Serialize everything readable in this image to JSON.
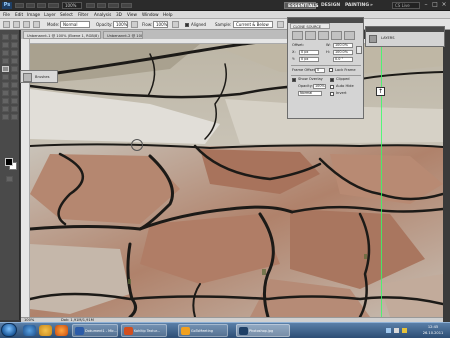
{
  "app": {
    "logo": "Ps",
    "zoom": "100%",
    "workspaces": [
      "ESSENTIALS",
      "DESIGN",
      "PAINTING",
      "»"
    ],
    "cs_live": "CS Live"
  },
  "menu": [
    "File",
    "Edit",
    "Image",
    "Layer",
    "Select",
    "Filter",
    "Analysis",
    "3D",
    "View",
    "Window",
    "Help"
  ],
  "options_bar": {
    "mode_label": "Mode:",
    "mode_value": "Normal",
    "opacity_label": "Opacity:",
    "opacity_value": "100%",
    "flow_label": "Flow:",
    "flow_value": "100%",
    "aligned_label": "Aligned",
    "sample_label": "Sample:",
    "sample_value": "Current & Below"
  },
  "document": {
    "tabs": [
      "Unbenannt-1 @ 100% (Ebene 1, RGB/8)",
      "Unbenannt-2 @ 100%"
    ]
  },
  "status": {
    "zoom": "100%",
    "doc_info": "Dok: 1,91M/1,91M"
  },
  "brush_popup": {
    "label": "Brushes"
  },
  "clone_source_panel": {
    "tabs": [
      "CLONE SOURCE"
    ],
    "offset_label": "Offset:",
    "w_label": "W:",
    "w_value": "100.0%",
    "h_label": "H:",
    "h_value": "100.0%",
    "x_label": "X:",
    "x_value": "0 px",
    "y_label": "Y:",
    "y_value": "0 px",
    "angle_value": "0.0 °",
    "frame_offset_label": "Frame Offset:",
    "frame_offset_value": "0",
    "lock_frame_label": "Lock Frame",
    "show_overlay_label": "Show Overlay",
    "clipped_label": "Clipped",
    "opacity_label": "Opacity:",
    "opacity_value": "100%",
    "auto_hide_label": "Auto Hide",
    "blend_value": "Normal",
    "invert_label": "Invert"
  },
  "layers_panel": {
    "tab": "LAYERS"
  },
  "taskbar": {
    "tasks": [
      "Dokument1 - Mic...",
      "Kohltip Textur...",
      "GoToMeeting",
      "Photoshop.jpg"
    ],
    "time": "12:45",
    "date": "26.10.2011"
  },
  "colors": {
    "accent": "#1e3f66",
    "guide": "#33ff66",
    "bark_light": "#d9d6cf",
    "bark_brown": "#a9725a",
    "crack": "#1c1a17"
  }
}
